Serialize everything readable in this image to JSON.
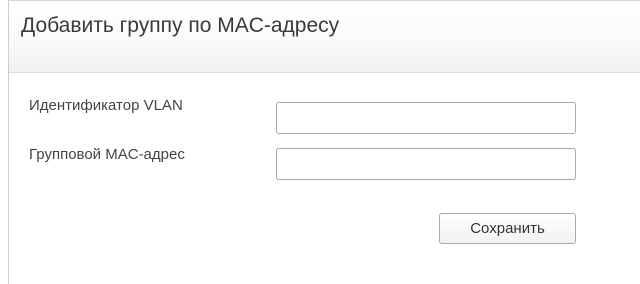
{
  "panel": {
    "title": "Добавить группу по MAC-адресу"
  },
  "form": {
    "vlan_id": {
      "label": "Идентификатор VLAN",
      "value": ""
    },
    "group_mac": {
      "label": "Групповой MAC-адрес",
      "value": ""
    },
    "save_label": "Сохранить"
  }
}
